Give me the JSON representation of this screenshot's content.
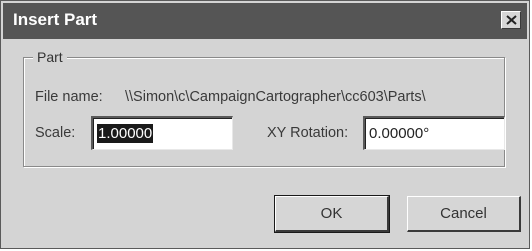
{
  "window": {
    "title": "Insert Part"
  },
  "group": {
    "label": "Part"
  },
  "file": {
    "label": "File name:",
    "value": "\\\\Simon\\c\\CampaignCartographer\\cc603\\Parts\\"
  },
  "scale": {
    "label": "Scale:",
    "value": "1.00000"
  },
  "rotation": {
    "label": "XY Rotation:",
    "value": "0.00000°"
  },
  "buttons": {
    "ok": "OK",
    "cancel": "Cancel"
  },
  "icons": {
    "close": "close-icon"
  }
}
